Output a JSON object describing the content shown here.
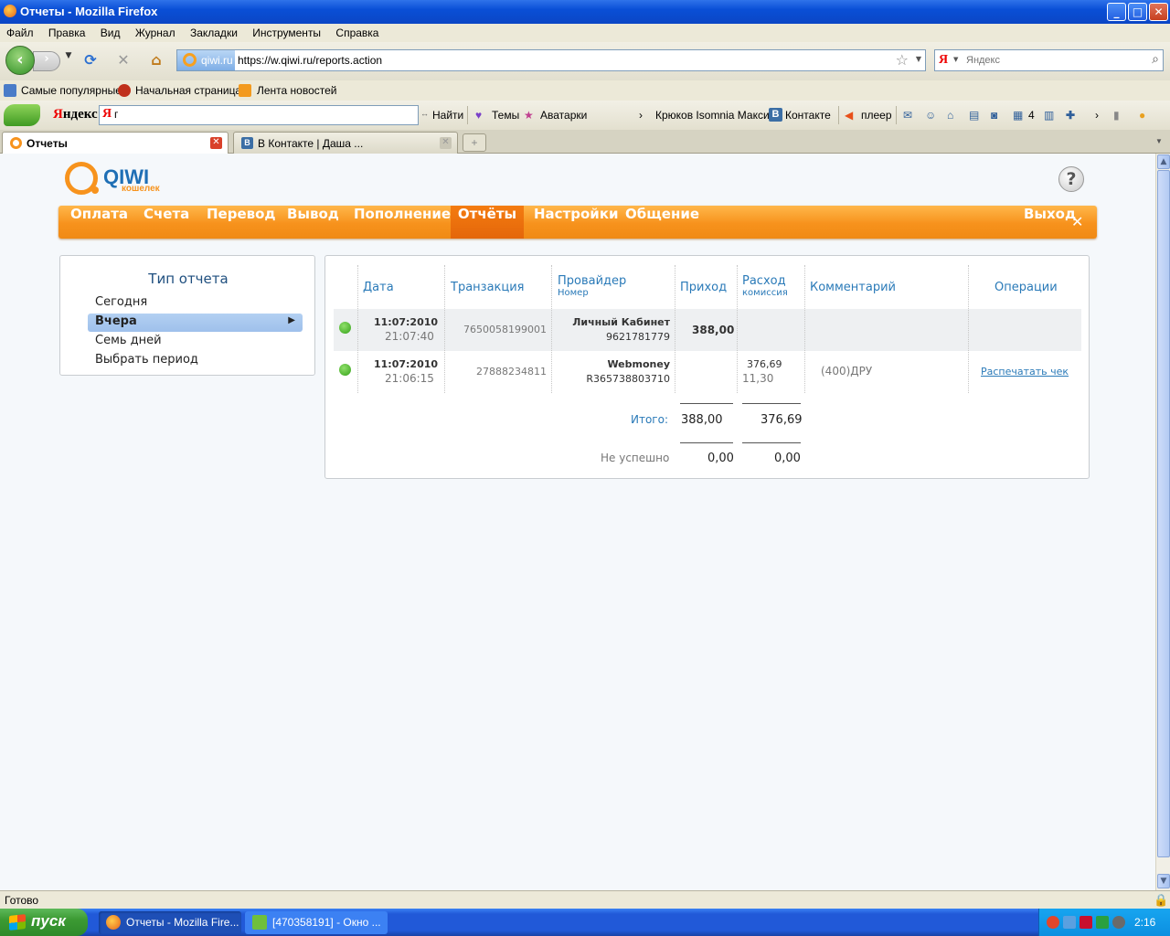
{
  "window": {
    "title": "Отчеты - Mozilla Firefox",
    "min": "_",
    "max": "□",
    "close": "✕"
  },
  "menu": [
    "Файл",
    "Правка",
    "Вид",
    "Журнал",
    "Закладки",
    "Инструменты",
    "Справка"
  ],
  "nav": {
    "site_label": "qiwi.ru",
    "url": "https://w.qiwi.ru/reports.action",
    "search_placeholder": "Яндекс",
    "search_engine": "Я"
  },
  "bookmarks": [
    "Самые популярные",
    "Начальная страница",
    "Лента новостей"
  ],
  "yandex_bar": {
    "logo_red": "Я",
    "logo_rest": "ндекс",
    "input_prefix": "Я",
    "input_value": "г",
    "find": "Найти",
    "themes": "Темы",
    "avatars": "Аватарки",
    "user": "Крюков Isomnia Максим",
    "vk": "Контакте",
    "player": "плеер",
    "count": "4"
  },
  "tabs": [
    {
      "label": "Отчеты",
      "active": true
    },
    {
      "label": "В Контакте | Даша ...",
      "active": false
    }
  ],
  "page": {
    "logo": {
      "word": "QIWI",
      "sub": "кошелек"
    },
    "help": "?",
    "main_nav": [
      "Оплата",
      "Счета",
      "Перевод",
      "Вывод",
      "Пополнение",
      "Отчёты",
      "Настройки",
      "Общение"
    ],
    "main_nav_selected": "Отчёты",
    "logout": "Выход",
    "report_type": {
      "title": "Тип отчета",
      "items": [
        "Сегодня",
        "Вчера",
        "Семь дней",
        "Выбрать период"
      ],
      "selected": "Вчера"
    },
    "table": {
      "headers": {
        "date": "Дата",
        "transaction": "Транзакция",
        "provider": "Провайдер",
        "provider_sub": "Номер",
        "income": "Приход",
        "expense": "Расход",
        "expense_sub": "комиссия",
        "comment": "Комментарий",
        "operations": "Операции"
      },
      "rows": [
        {
          "date": "11:07:2010",
          "time": "21:07:40",
          "transaction": "7650058199001",
          "provider": "Личный Кабинет",
          "number": "9621781779",
          "income": "388,00",
          "expense": "",
          "commission": "",
          "comment": "",
          "operation": "",
          "status_color": "#35a21a"
        },
        {
          "date": "11:07:2010",
          "time": "21:06:15",
          "transaction": "27888234811",
          "provider": "Webmoney",
          "number": "R365738803710",
          "income": "",
          "expense": "376,69",
          "commission": "11,30",
          "comment": "(400)ДРУ",
          "operation": "Распечатать чек",
          "status_color": "#35a21a"
        }
      ],
      "totals": {
        "label": "Итого:",
        "income": "388,00",
        "expense": "376,69"
      },
      "failed": {
        "label": "Не успешно",
        "income": "0,00",
        "expense": "0,00"
      }
    }
  },
  "status": "Готово",
  "taskbar": {
    "start": "пуск",
    "tasks": [
      "Отчеты - Mozilla Fire...",
      "[470358191] - Окно ..."
    ],
    "clock": "2:16"
  },
  "colors": {
    "accent_orange": "#f7931d",
    "link_blue": "#2a7ab8",
    "status_green": "#35a21a"
  }
}
